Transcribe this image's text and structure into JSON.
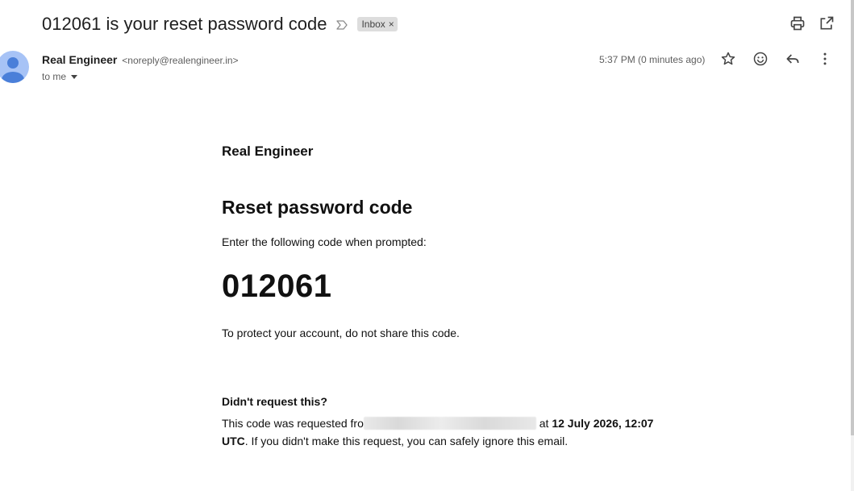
{
  "header": {
    "subject": "012061 is your reset password code",
    "label_chip": "Inbox",
    "label_chip_remove": "×"
  },
  "message": {
    "sender_name": "Real Engineer",
    "sender_email": "<noreply@realengineer.in>",
    "recipient": "to me",
    "time": "5:37 PM (0 minutes ago)"
  },
  "email": {
    "brand": "Real Engineer",
    "title": "Reset password code",
    "instruction": "Enter the following code when prompted:",
    "code": "012061",
    "protect_note": "To protect your account, do not share this code.",
    "didnt_request_heading": "Didn't request this?",
    "requested_prefix": "This code was requested fro",
    "requested_at": "at",
    "requested_datetime": "12 July 2026, 12:07 UTC",
    "requested_suffix": ". If you didn't make this request, you can safely ignore this email."
  },
  "icons": {
    "important": "important-marker-icon",
    "print": "print-icon",
    "open_new_window": "open-in-new-window-icon",
    "star": "star-icon",
    "emoji": "emoji-reaction-icon",
    "reply": "reply-icon",
    "more": "more-vert-icon",
    "avatar": "avatar-person-icon"
  },
  "colors": {
    "avatar_bg": "#a7c3f6",
    "avatar_fg": "#4a7fd9",
    "chip_bg": "#dddddd",
    "text": "#1f1f1f",
    "muted": "#5e5e5e"
  }
}
